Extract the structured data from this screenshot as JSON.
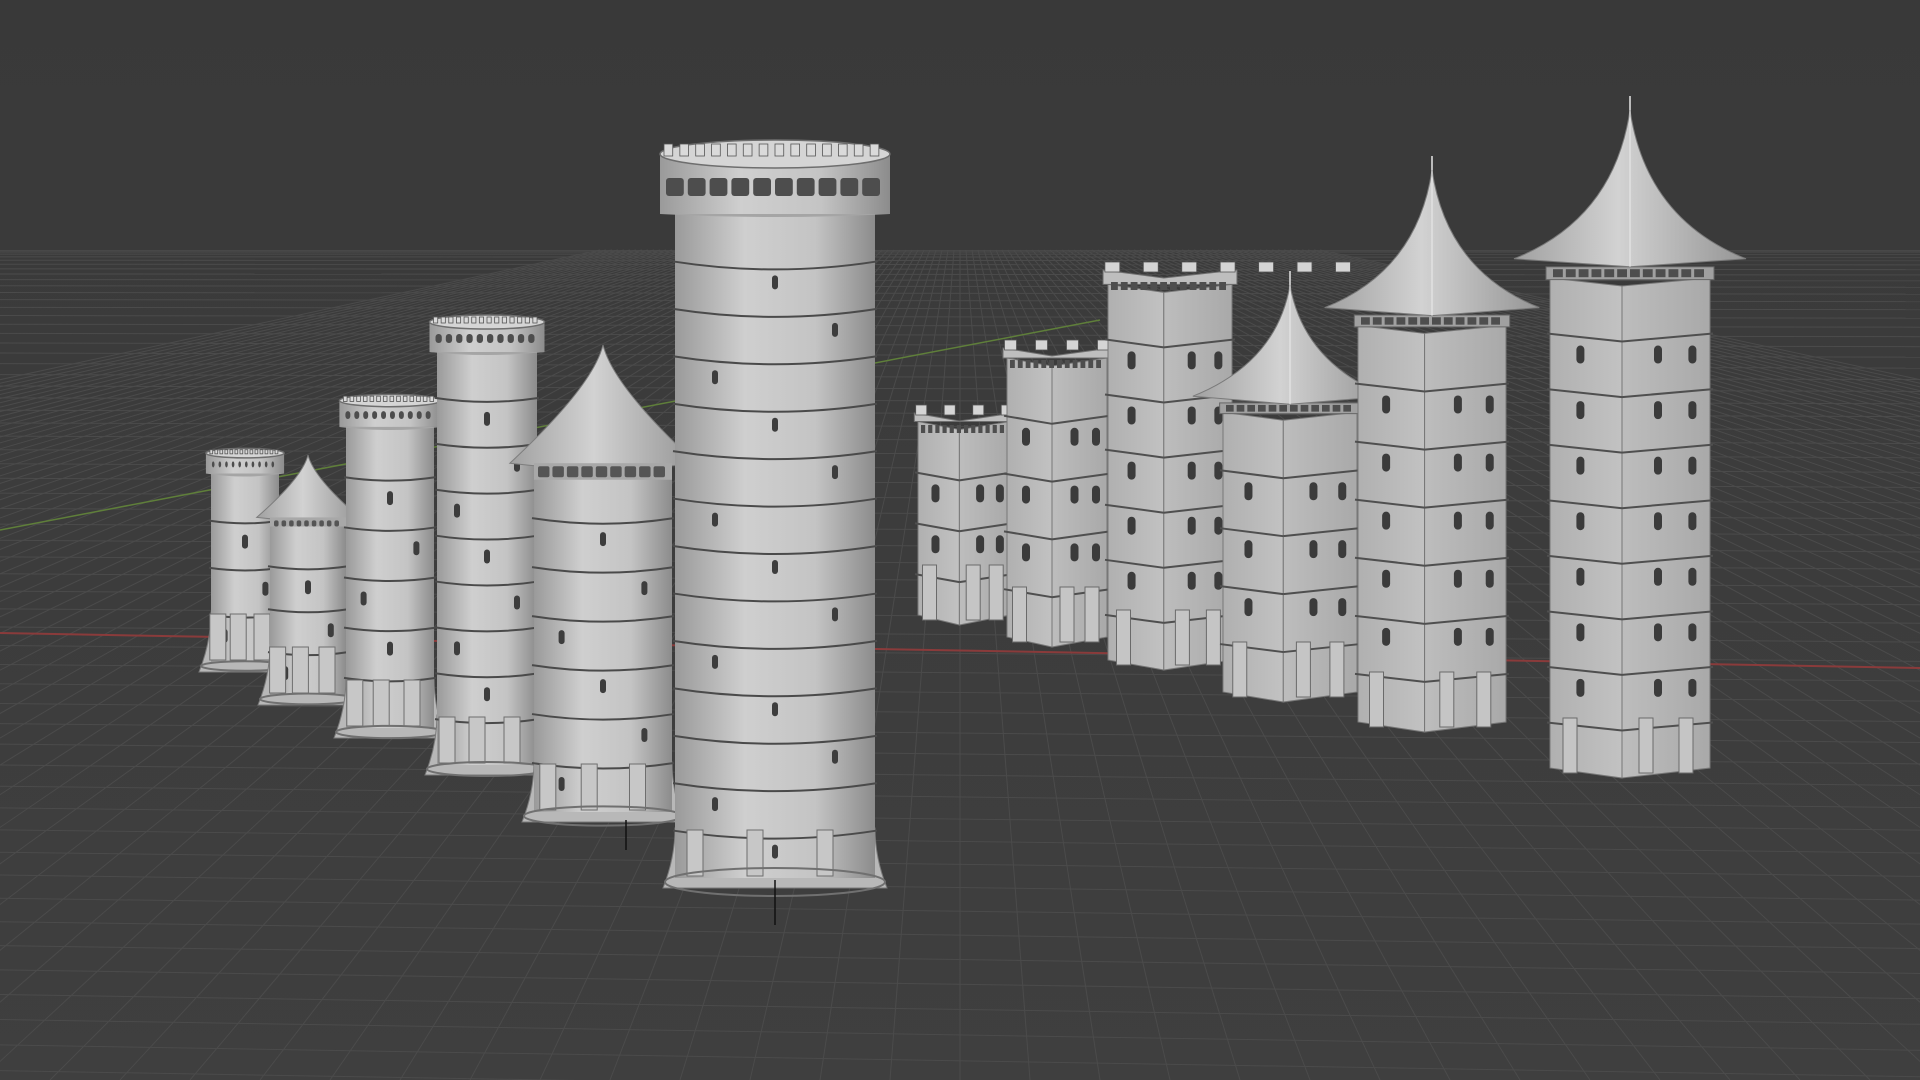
{
  "viewport": {
    "background": "#3c3c3c",
    "grid_color": "#4b4b4b",
    "x_axis_color": "#8a3b3b",
    "y_axis_color": "#5f7f3a"
  },
  "round_towers": [
    {
      "id": "round-tower-1",
      "roof": "crenellated"
    },
    {
      "id": "round-tower-2",
      "roof": "cone"
    },
    {
      "id": "round-tower-3",
      "roof": "crenellated"
    },
    {
      "id": "round-tower-4",
      "roof": "crenellated"
    },
    {
      "id": "round-tower-5",
      "roof": "cone"
    },
    {
      "id": "round-tower-6",
      "roof": "crenellated"
    }
  ],
  "square_towers": [
    {
      "id": "square-tower-1",
      "roof": "crenellated"
    },
    {
      "id": "square-tower-2",
      "roof": "crenellated"
    },
    {
      "id": "square-tower-3",
      "roof": "crenellated"
    },
    {
      "id": "square-tower-4",
      "roof": "spire"
    },
    {
      "id": "square-tower-5",
      "roof": "spire"
    },
    {
      "id": "square-tower-6",
      "roof": "spire"
    }
  ],
  "colors": {
    "model_light": "#c9c9c9",
    "model_mid": "#b3b3b3",
    "model_dark": "#8f8f8f",
    "model_shadow": "#6e6e6e"
  }
}
